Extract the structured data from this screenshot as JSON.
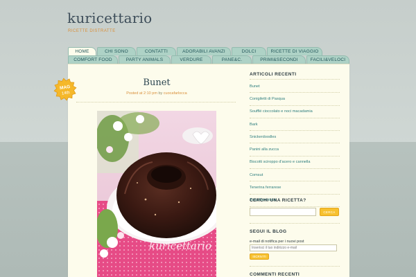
{
  "site": {
    "title": "kuricettario",
    "description": "RICETTE DISTRATTE"
  },
  "nav": {
    "row1": [
      "HOME",
      "CHI SONO",
      "CONTATTI",
      "ADORABILI AVANZI",
      "DOLCI",
      "RICETTE DI VIAGGIO"
    ],
    "row2": [
      "COMFORT FOOD",
      "PARTY ANIMALS",
      "VERDURE",
      "PANE&C.",
      "PRIMI&SECONDI",
      "FACILI&VELOCI"
    ]
  },
  "post": {
    "date_month": "MAG",
    "date_day": "14th",
    "title": "Bunet",
    "meta_prefix": "Posted at 2:10 pm",
    "meta_by": "by",
    "author": "cuocafarlocca",
    "photo_watermark": "kuricettario"
  },
  "sidebar": {
    "recent_title": "ARTICOLI RECENTI",
    "recent_posts": [
      "Bunet",
      "Conigiletti di Pasqua",
      "Soufflé cioccolato e noci macadamia",
      "Bark",
      "Snickerdoodles",
      "Panini alla zucca",
      "Biscotti sciroppo d'acero e cannella",
      "Comsut",
      "Tenerina ferrarese",
      "Torta Beninteisi"
    ],
    "search_title": "CERCHI UNA RICETTA?",
    "search_value": "",
    "search_button": "CERCA",
    "follow_title": "SEGUI IL BLOG",
    "follow_text": "e-mail di notifica per i nuovi post",
    "email_placeholder": "Inserisci il tuo indirizzo e-mail",
    "follow_button": "ISCRIVITI",
    "comments_title": "COMMENTI RECENTI"
  },
  "colors": {
    "accent": "#d98f3a",
    "link": "#2c7d7d",
    "tab": "#aed2c6",
    "paper": "#fdfcec",
    "button": "#f7c12f"
  }
}
